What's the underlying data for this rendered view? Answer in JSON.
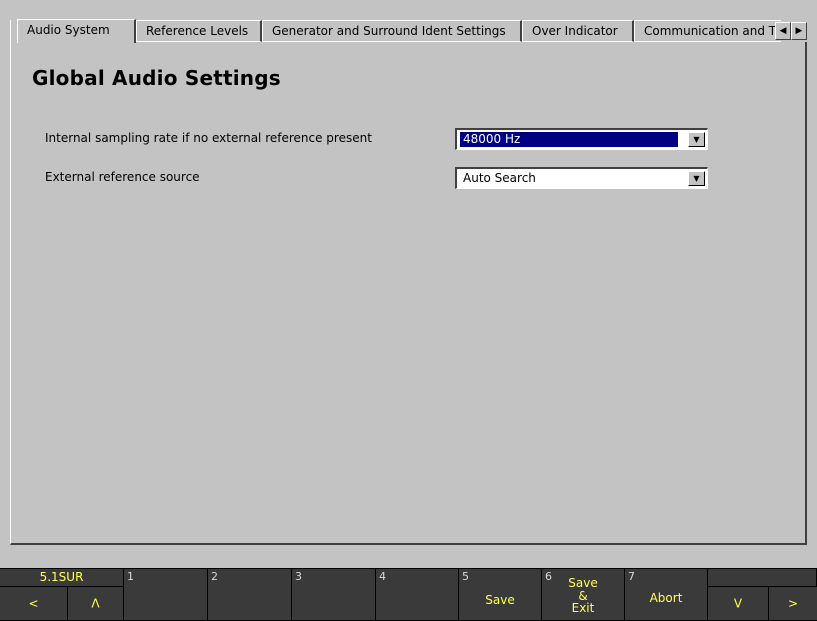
{
  "tabs": {
    "items": [
      {
        "label": "Audio System",
        "active": true
      },
      {
        "label": "Reference Levels",
        "active": false
      },
      {
        "label": "Generator and Surround Ident Settings",
        "active": false
      },
      {
        "label": "Over Indicator",
        "active": false
      },
      {
        "label": "Communication and Tir",
        "active": false
      }
    ],
    "scroll_left_icon": "◀",
    "scroll_right_icon": "▶"
  },
  "main": {
    "title": "Global Audio Settings",
    "settings": [
      {
        "label": "Internal sampling rate if no external reference present",
        "value": "48000 Hz",
        "focused": true
      },
      {
        "label": "External reference source",
        "value": "Auto Search",
        "focused": false
      }
    ],
    "dropdown_icon": "▼"
  },
  "softkeys": {
    "mode_label": "5.1SUR",
    "left_arrow": "<",
    "up_arrow": "Λ",
    "keys": [
      {
        "num": "1",
        "label": ""
      },
      {
        "num": "2",
        "label": ""
      },
      {
        "num": "3",
        "label": ""
      },
      {
        "num": "4",
        "label": ""
      },
      {
        "num": "5",
        "label": "Save"
      },
      {
        "num": "6",
        "label_line1": "Save",
        "label_line2": "&",
        "label_line3": "Exit"
      },
      {
        "num": "7",
        "label": "Abort"
      }
    ],
    "down_arrow": "V",
    "right_arrow": ">"
  },
  "colors": {
    "background": "#c3c3c3",
    "selection": "#000080",
    "softkey_bg": "#3a3a3a",
    "softkey_text": "#ffff55"
  }
}
